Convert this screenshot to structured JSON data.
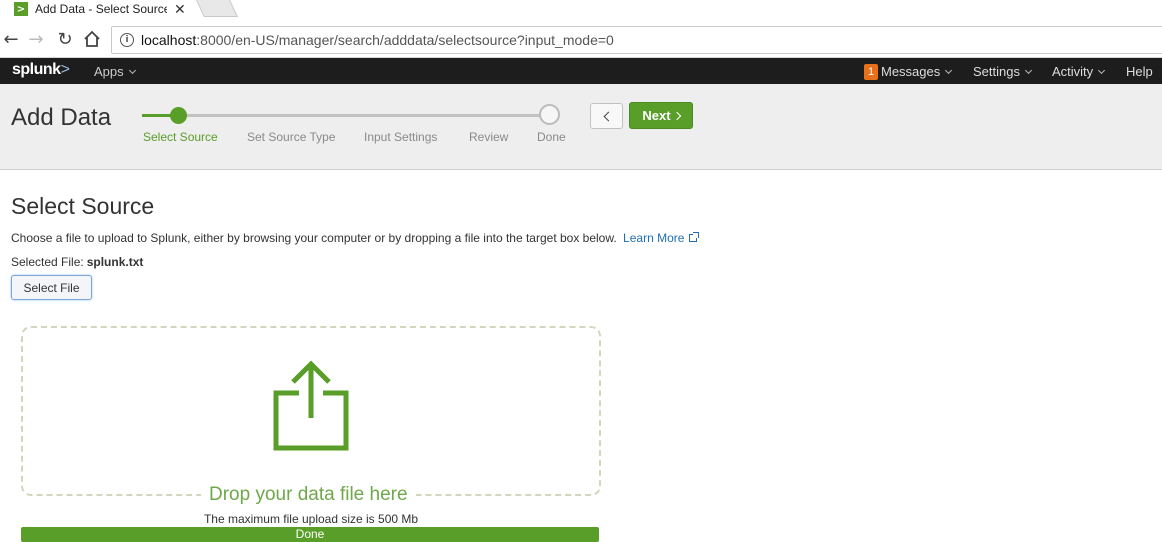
{
  "browser": {
    "tab_title": "Add Data - Select Source",
    "favicon_text": ">",
    "close_glyph": "✕",
    "url_host": "localhost",
    "url_rest": ":8000/en-US/manager/search/adddata/selectsource?input_mode=0"
  },
  "splunk_bar": {
    "logo_text": "splunk",
    "logo_suffix": ">",
    "apps_label": "Apps",
    "messages_count": "1",
    "messages_label": "Messages",
    "settings_label": "Settings",
    "activity_label": "Activity",
    "help_label": "Help"
  },
  "header": {
    "title": "Add Data",
    "steps": [
      {
        "label": "Select Source",
        "active": true
      },
      {
        "label": "Set Source Type",
        "active": false
      },
      {
        "label": "Input Settings",
        "active": false
      },
      {
        "label": "Review",
        "active": false
      },
      {
        "label": "Done",
        "active": false
      }
    ],
    "next_label": "Next"
  },
  "main": {
    "section_title": "Select Source",
    "description": "Choose a file to upload to Splunk, either by browsing your computer or by dropping a file into the target box below.",
    "learn_more": "Learn More",
    "selected_file_label": "Selected File:",
    "selected_file_value": "splunk.txt",
    "select_file_button": "Select File",
    "drop_text": "Drop your data file here",
    "max_size_text": "The maximum file upload size is 500 Mb",
    "upload_progress_label": "Done",
    "upload_progress_fraction": 1.0
  },
  "colors": {
    "accent_green": "#5a9e2a",
    "link_blue": "#1e6fb3",
    "badge_orange": "#e8701a"
  }
}
